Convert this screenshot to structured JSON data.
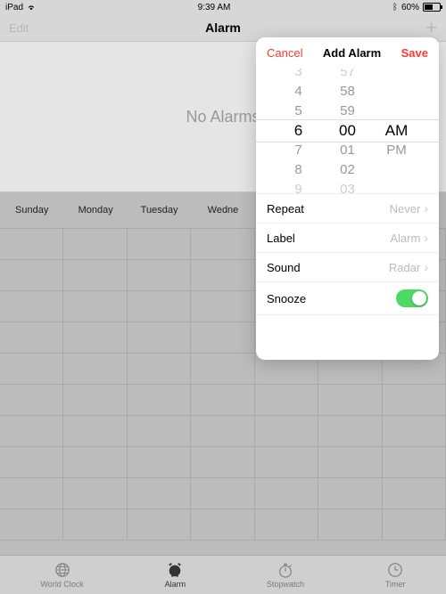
{
  "status": {
    "device": "iPad",
    "time": "9:39 AM",
    "battery": "60%"
  },
  "nav": {
    "edit": "Edit",
    "title": "Alarm",
    "plus": "+"
  },
  "empty": {
    "text": "No Alarms"
  },
  "days": [
    "Sunday",
    "Monday",
    "Tuesday",
    "Wedne",
    "",
    "",
    ""
  ],
  "popover": {
    "cancel": "Cancel",
    "title": "Add Alarm",
    "save": "Save",
    "picker": {
      "hours": [
        "3",
        "4",
        "5",
        "6",
        "7",
        "8",
        "9"
      ],
      "minutes": [
        "57",
        "58",
        "59",
        "00",
        "01",
        "02",
        "03"
      ],
      "ampm": [
        "AM",
        "PM"
      ]
    },
    "settings": {
      "repeat": {
        "label": "Repeat",
        "value": "Never"
      },
      "label": {
        "label": "Label",
        "value": "Alarm"
      },
      "sound": {
        "label": "Sound",
        "value": "Radar"
      },
      "snooze": {
        "label": "Snooze",
        "on": true
      }
    }
  },
  "tabs": {
    "worldclock": "World Clock",
    "alarm": "Alarm",
    "stopwatch": "Stopwatch",
    "timer": "Timer"
  }
}
